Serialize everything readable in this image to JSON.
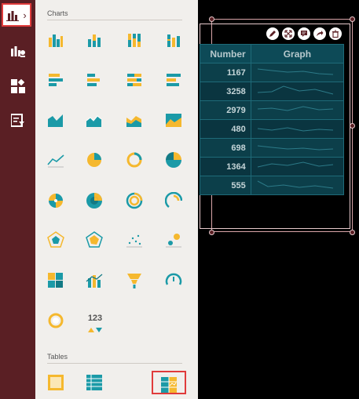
{
  "rail": {
    "items": [
      {
        "name": "charts-menu",
        "icon": "bar-chart-icon",
        "active": true,
        "chevron": "›"
      },
      {
        "name": "datasource",
        "icon": "data-source-icon"
      },
      {
        "name": "widgets",
        "icon": "widgets-grid-icon"
      },
      {
        "name": "filter",
        "icon": "filter-icon"
      }
    ]
  },
  "panel": {
    "charts_title": "Charts",
    "tables_title": "Tables",
    "number_card_label": "123"
  },
  "widget": {
    "columns": [
      "Number",
      "Graph"
    ],
    "rows": [
      "1167",
      "3258",
      "2979",
      "480",
      "698",
      "1364",
      "555"
    ],
    "toolbar": [
      "edit-icon",
      "expand-icon",
      "comment-icon",
      "share-icon",
      "delete-icon"
    ]
  },
  "colors": {
    "rail": "#5a1f24",
    "teal": "#1b9aa7",
    "yellow": "#f5b82e",
    "selection": "#e03b3b"
  }
}
